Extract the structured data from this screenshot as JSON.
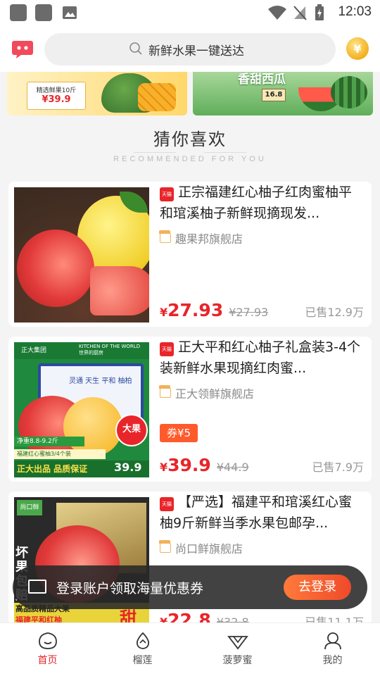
{
  "status_bar": {
    "time": "12:03"
  },
  "header": {
    "search_placeholder": "新鲜水果一键送达",
    "coin_symbol": "¥"
  },
  "banners": {
    "left": {
      "labels": [
        "精选鲜果10斤",
        "¥39.9"
      ]
    },
    "right": {
      "labels": [
        "香甜西瓜",
        "16.8"
      ]
    }
  },
  "section": {
    "title": "猜你喜欢",
    "subtitle": "RECOMMENDED FOR YOU"
  },
  "products": [
    {
      "tag": "天猫",
      "title": "正宗福建红心柚子红肉蜜柚平和琯溪柚子新鲜现摘现发...",
      "shop": "趣果邦旗舰店",
      "coupon": "",
      "price": "27.93",
      "old_price": "¥27.93",
      "sold": "已售12.9万"
    },
    {
      "tag": "天猫",
      "title": "正大平和红心柚子礼盒装3-4个装新鲜水果现摘红肉蜜...",
      "shop": "正大领鲜旗舰店",
      "coupon": "券¥5",
      "price": "39.9",
      "old_price": "¥44.9",
      "sold": "已售7.9万",
      "image_labels": [
        "正大集团",
        "KITCHEN OF THE WORLD 世界的厨房",
        "灵通 天生 平和 柚柏",
        "大果",
        "净重8.8-9.2斤",
        "福建红心蜜柚3/4个装",
        "正大出品 品质保证",
        "39.9"
      ]
    },
    {
      "tag": "天猫",
      "title": "【严选】福建平和琯溪红心蜜柚9斤新鲜当季水果包邮孕...",
      "shop": "尚口鲜旗舰店",
      "coupon": "",
      "price": "22.8",
      "old_price": "¥32.8",
      "sold": "已售11.1万",
      "image_labels": [
        "尚口鲜",
        "坏果包赔",
        "高品质精品大果",
        "福建平和红柚",
        "甜"
      ]
    }
  ],
  "price_symbol": "¥",
  "toast": {
    "text": "登录账户领取海量优惠券",
    "button": "去登录"
  },
  "bottom_nav": [
    {
      "label": "首页",
      "active": true
    },
    {
      "label": "榴莲",
      "active": false
    },
    {
      "label": "菠萝蜜",
      "active": false
    },
    {
      "label": "我的",
      "active": false
    }
  ],
  "colors": {
    "accent": "#e8252a",
    "coupon": "#ff5a2c",
    "toast_button": "#ee4a2a"
  }
}
